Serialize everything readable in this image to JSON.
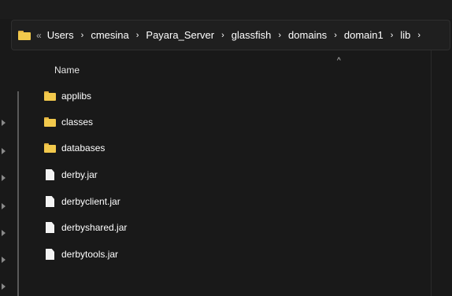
{
  "address_bar": {
    "overflow_glyph": "«",
    "crumbs": [
      "Users",
      "cmesina",
      "Payara_Server",
      "glassfish",
      "domains",
      "domain1",
      "lib"
    ],
    "separator": "›",
    "icon": "folder-icon"
  },
  "list": {
    "column_name": "Name",
    "sort_glyph": "^",
    "items": [
      {
        "name": "applibs",
        "icon": "folder-icon"
      },
      {
        "name": "classes",
        "icon": "folder-icon"
      },
      {
        "name": "databases",
        "icon": "folder-icon"
      },
      {
        "name": "derby.jar",
        "icon": "file-icon"
      },
      {
        "name": "derbyclient.jar",
        "icon": "file-icon"
      },
      {
        "name": "derbyshared.jar",
        "icon": "file-icon"
      },
      {
        "name": "derbytools.jar",
        "icon": "file-icon"
      }
    ]
  },
  "colors": {
    "background": "#191919",
    "folder": "#f2c94c",
    "text": "#ffffff"
  }
}
